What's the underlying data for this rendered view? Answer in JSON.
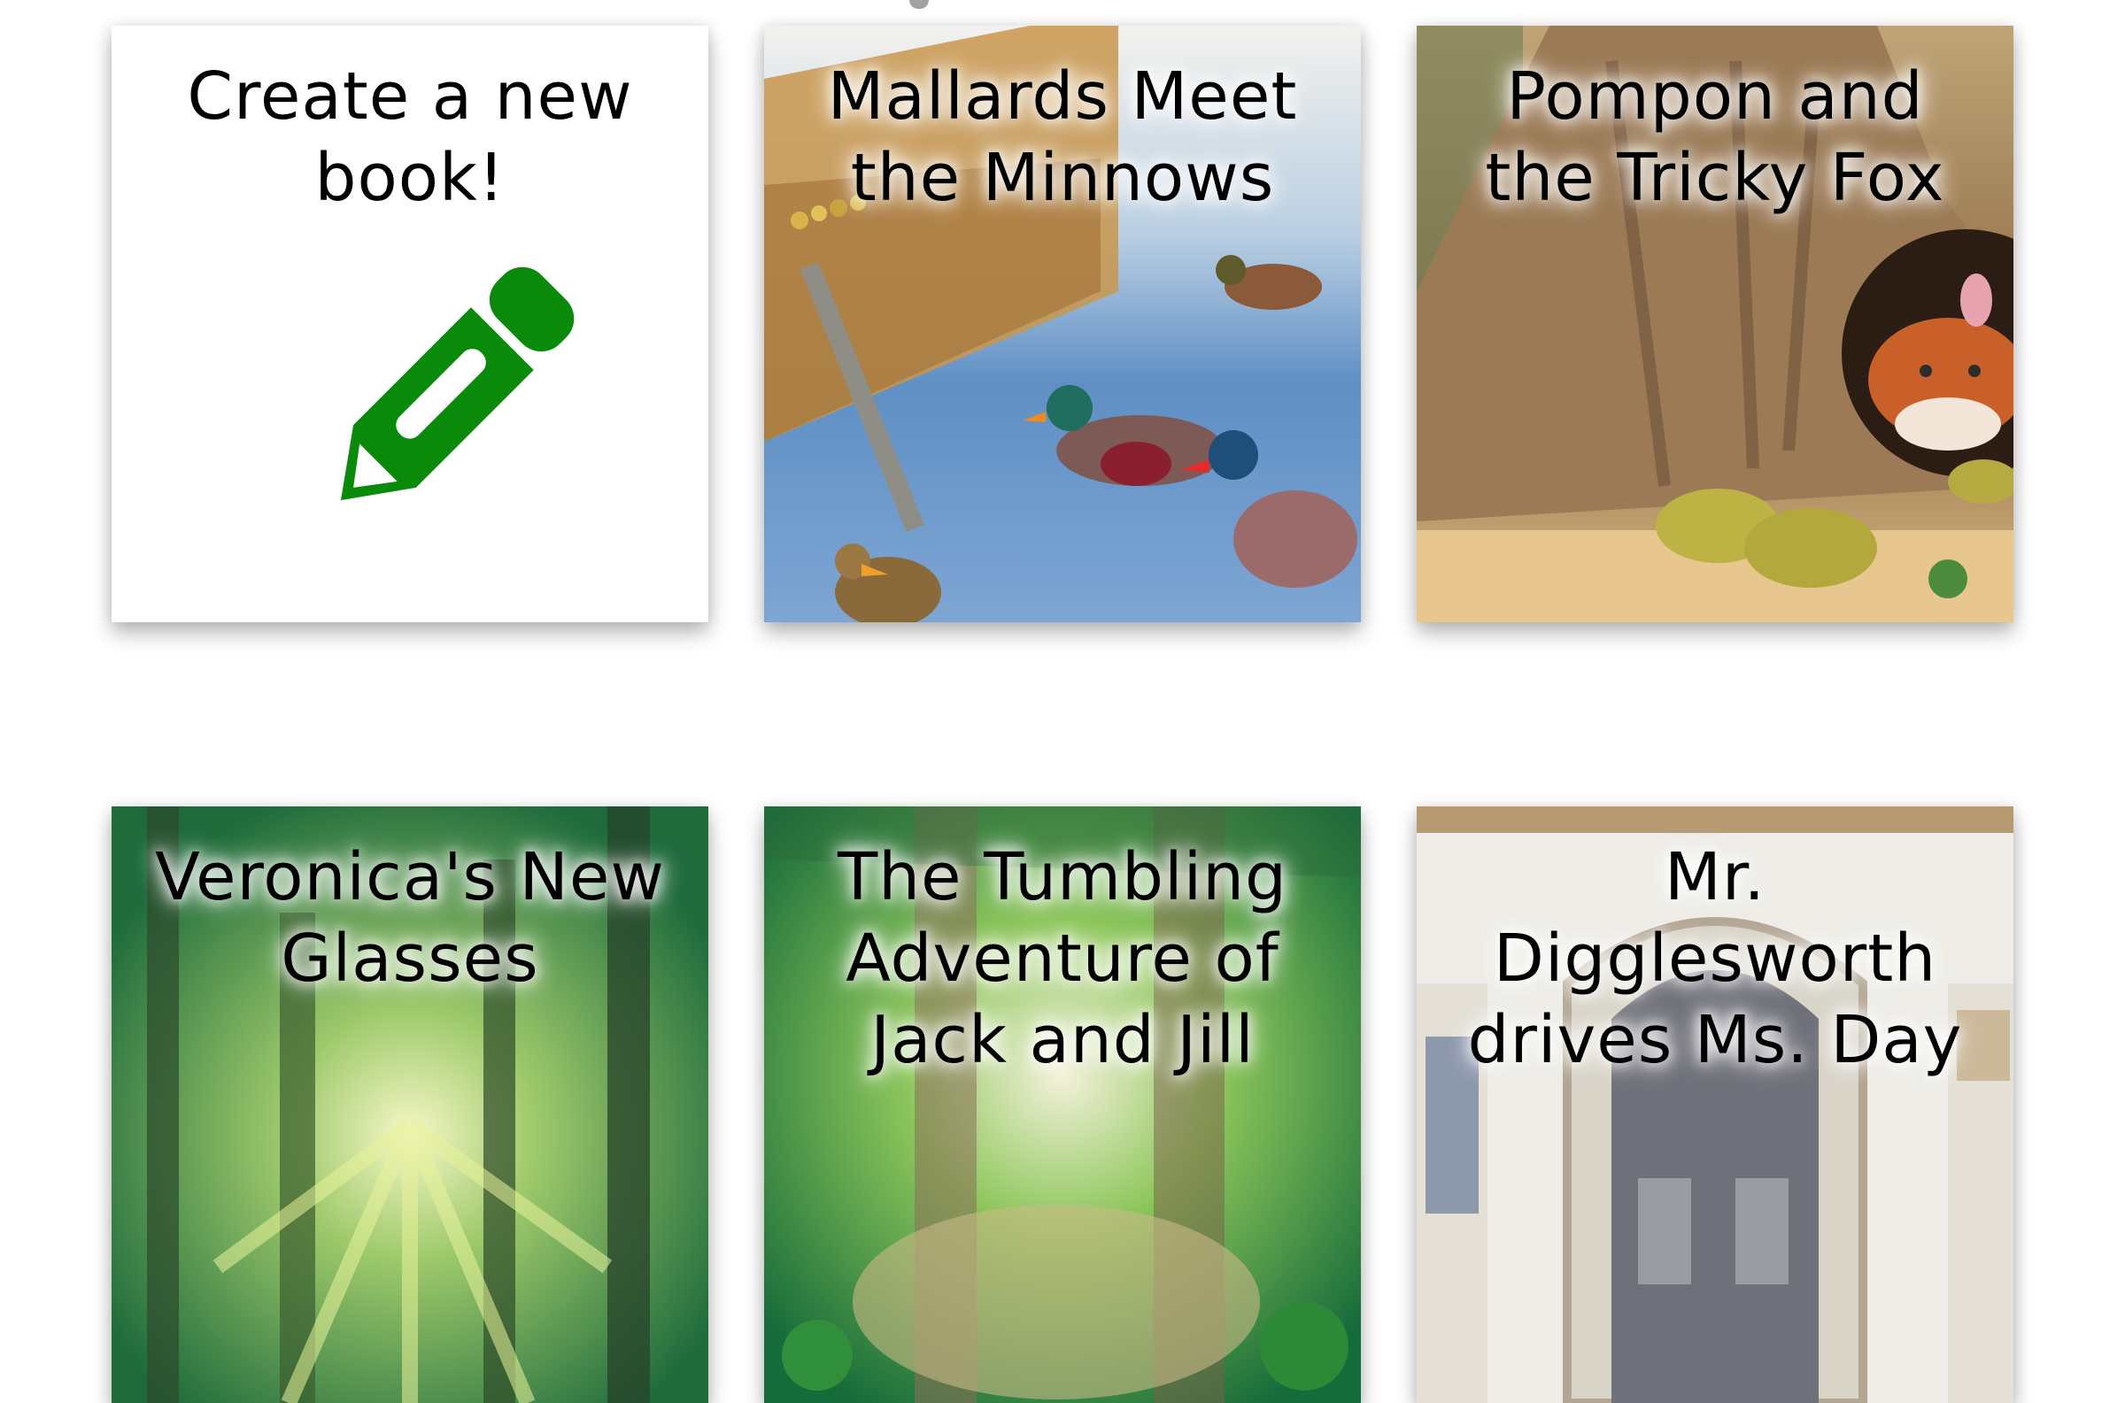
{
  "books": [
    {
      "title": "Create a new book!",
      "icon": "pencil-icon",
      "accent": "#0a8a0a"
    },
    {
      "title": "Mallards Meet the Minnows"
    },
    {
      "title": "Pompon and the Tricky Fox"
    },
    {
      "title": "Veronica's New Glasses"
    },
    {
      "title": "The Tumbling Adventure of Jack and Jill"
    },
    {
      "title": "Mr. Digglesworth drives Ms. Day"
    }
  ]
}
